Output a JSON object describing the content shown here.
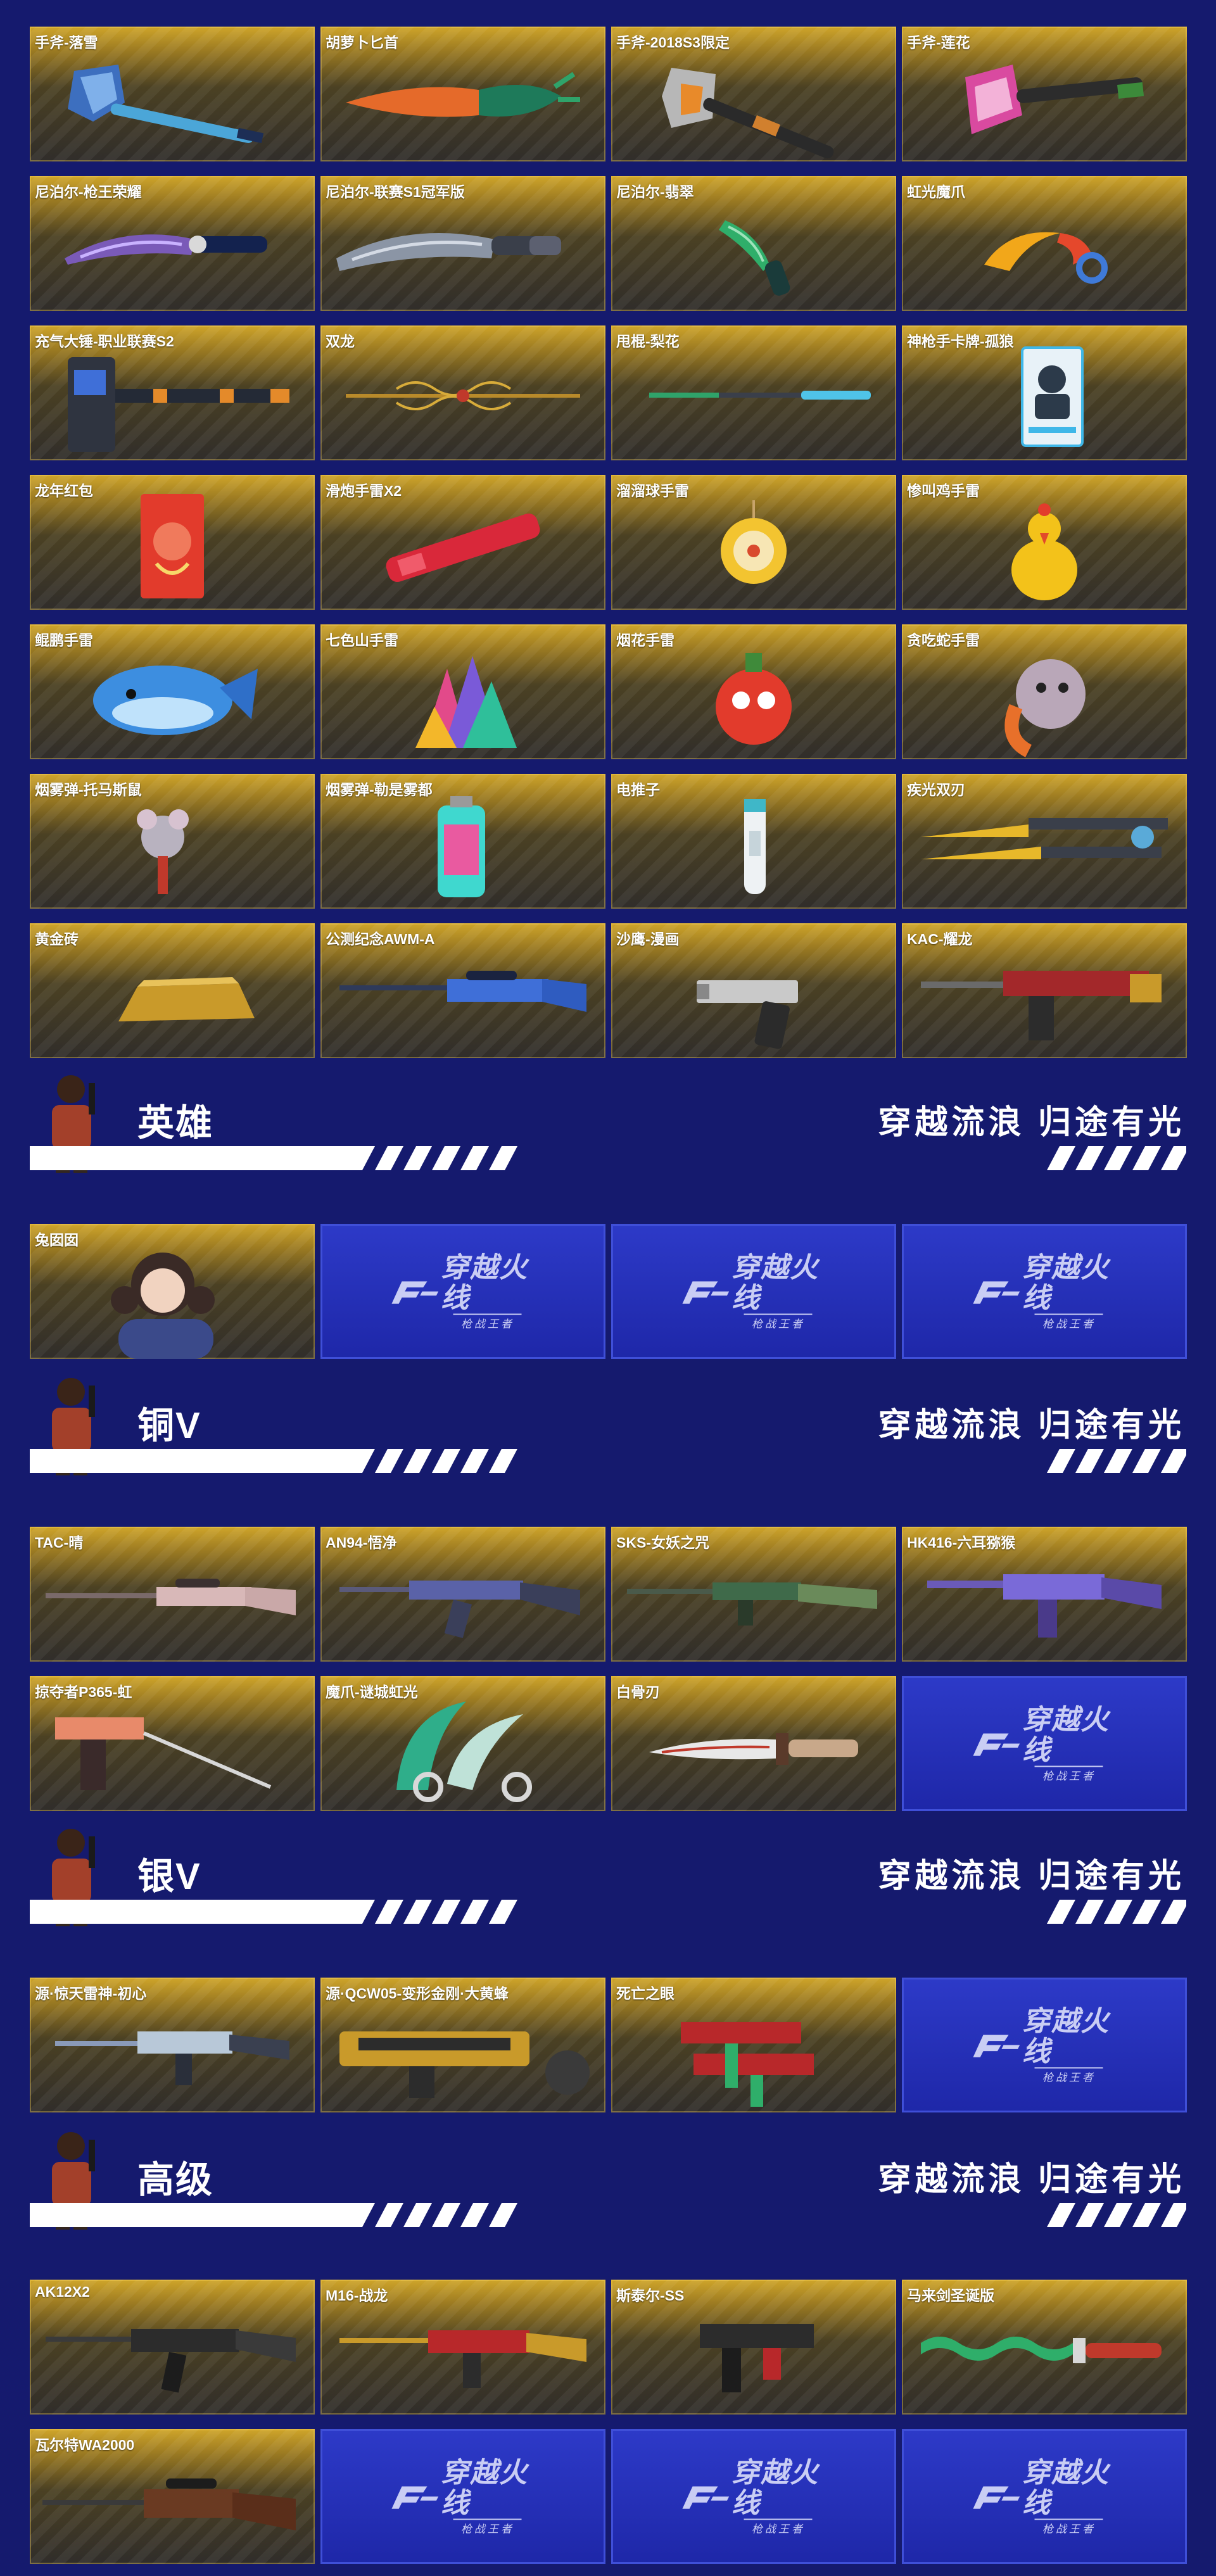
{
  "sections": {
    "top": {
      "items": [
        "手斧-落雪",
        "胡萝卜匕首",
        "手斧-2018S3限定",
        "手斧-莲花",
        "尼泊尔-枪王荣耀",
        "尼泊尔-联赛S1冠军版",
        "尼泊尔-翡翠",
        "虹光魔爪",
        "充气大锤-职业联赛S2",
        "双龙",
        "甩棍-梨花",
        "神枪手卡牌-孤狼",
        "龙年红包",
        "滑炮手雷X2",
        "溜溜球手雷",
        "惨叫鸡手雷",
        "鲲鹏手雷",
        "七色山手雷",
        "烟花手雷",
        "贪吃蛇手雷",
        "烟雾弹-托马斯鼠",
        "烟雾弹-勒是雾都",
        "电推子",
        "疾光双刃",
        "黄金砖",
        "公测纪念AWM-A",
        "沙鹰-漫画",
        "KAC-耀龙"
      ]
    },
    "hero": {
      "title": "英雄",
      "slogan": "穿越流浪 归途有光",
      "items": [
        "兔囡囡"
      ]
    },
    "copper": {
      "title": "铜V",
      "slogan": "穿越流浪 归途有光",
      "items": [
        "TAC-晴",
        "AN94-悟净",
        "SKS-女妖之咒",
        "HK416-六耳猕猴",
        "掠夺者P365-虹",
        "魔爪-谜城虹光",
        "白骨刃"
      ]
    },
    "silver": {
      "title": "银V",
      "slogan": "穿越流浪 归途有光",
      "items": [
        "源·惊天雷神-初心",
        "源·QCW05-变形金刚·大黄蜂",
        "死亡之眼"
      ]
    },
    "senior": {
      "title": "高级",
      "slogan": "穿越流浪 归途有光",
      "items": [
        "AK12X2",
        "M16-战龙",
        "斯泰尔-SS",
        "马来剑圣诞版",
        "瓦尔特WA2000"
      ]
    }
  },
  "logo": {
    "main": "穿越火线",
    "sub": "枪战王者"
  },
  "colors": {
    "page_bg": "#151a6e",
    "card_gold": "#cfa52a",
    "placeholder_blue": "#1e27a8"
  }
}
